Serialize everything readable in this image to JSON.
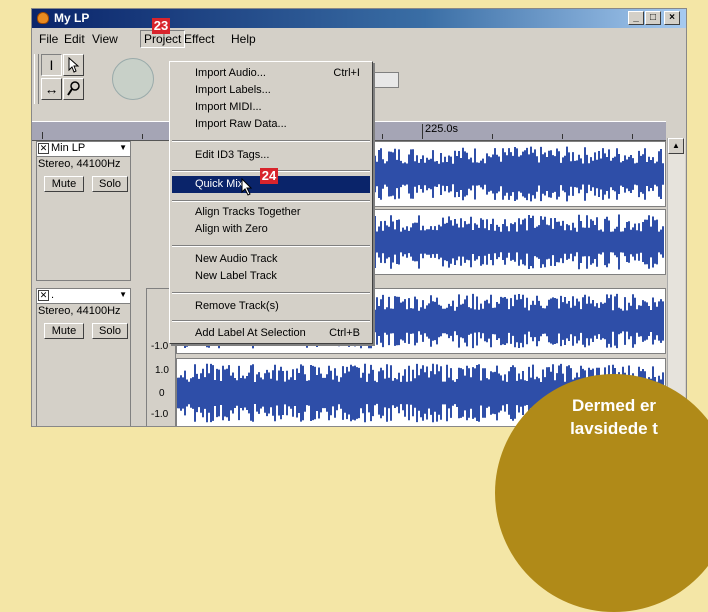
{
  "window": {
    "title": "My LP",
    "controls": [
      "_",
      "□",
      "×"
    ]
  },
  "menubar": {
    "items": [
      {
        "label": "File"
      },
      {
        "label": "Edit"
      },
      {
        "label": "View"
      },
      {
        "label": "Project"
      },
      {
        "label": "Effect"
      },
      {
        "label": "Help"
      }
    ]
  },
  "ruler": {
    "label": "225.0s"
  },
  "tracks": [
    {
      "name": "Min LP",
      "format": "Stereo, 44100Hz",
      "mute": "Mute",
      "solo": "Solo"
    },
    {
      "name": ".",
      "format": "Stereo, 44100Hz",
      "mute": "Mute",
      "solo": "Solo"
    }
  ],
  "scale": {
    "pos": "1.0",
    "zero": "0",
    "neg": "-1.0"
  },
  "project_menu": {
    "items": [
      {
        "label": "Import Audio...",
        "shortcut": "Ctrl+I"
      },
      {
        "label": "Import Labels..."
      },
      {
        "label": "Import MIDI..."
      },
      {
        "label": "Import Raw Data..."
      },
      {
        "label": "Edit ID3 Tags..."
      },
      {
        "label": "Quick Mix",
        "highlighted": true
      },
      {
        "label": "Align Tracks Together"
      },
      {
        "label": "Align with Zero"
      },
      {
        "label": "New Audio Track"
      },
      {
        "label": "New Label Track"
      },
      {
        "label": "Remove Track(s)"
      },
      {
        "label": "Add Label At Selection",
        "shortcut": "Ctrl+B"
      }
    ]
  },
  "badges": {
    "menu_step": "23",
    "item_step": "24"
  },
  "promo": {
    "line1": "Dermed er",
    "line2": "lavsidede t"
  },
  "colors": {
    "waveform": "#2e4ea8",
    "highlight": "#0a246a",
    "badge": "#d8242c",
    "background": "#f4e6a6"
  }
}
